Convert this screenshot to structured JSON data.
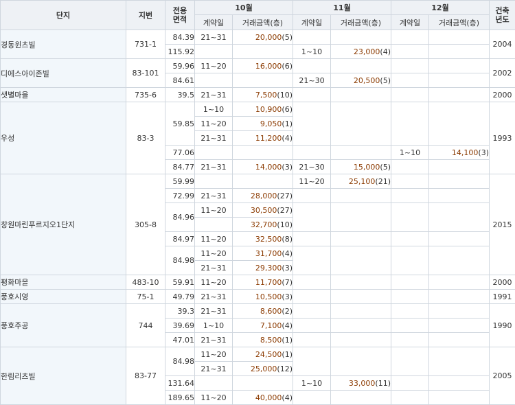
{
  "headers": {
    "complex": "단지",
    "jibun": "지번",
    "area": "전용\n면적",
    "months": [
      "10월",
      "11월",
      "12월"
    ],
    "contract_date": "계약일",
    "amount": "거래금액(층)",
    "built_year": "건축\n년도"
  },
  "complexes": [
    {
      "name": "경동윈츠빌",
      "jibun": "731-1",
      "year": "2004",
      "units": [
        {
          "area": "84.39",
          "deals": [
            {
              "m": 0,
              "date": "21~31",
              "amount": "20,000",
              "floor": "(5)"
            }
          ]
        },
        {
          "area": "115.92",
          "deals": [
            {
              "m": 1,
              "date": "1~10",
              "amount": "23,000",
              "floor": "(4)"
            }
          ]
        }
      ]
    },
    {
      "name": "디에스아이존빌",
      "jibun": "83-101",
      "year": "2002",
      "units": [
        {
          "area": "59.96",
          "deals": [
            {
              "m": 0,
              "date": "11~20",
              "amount": "16,000",
              "floor": "(6)"
            }
          ]
        },
        {
          "area": "84.61",
          "deals": [
            {
              "m": 1,
              "date": "21~30",
              "amount": "20,500",
              "floor": "(5)"
            }
          ]
        }
      ]
    },
    {
      "name": "샛별마을",
      "jibun": "735-6",
      "year": "2000",
      "units": [
        {
          "area": "39.5",
          "deals": [
            {
              "m": 0,
              "date": "21~31",
              "amount": "7,500",
              "floor": "(10)"
            }
          ]
        }
      ]
    },
    {
      "name": "우성",
      "jibun": "83-3",
      "year": "1993",
      "units": [
        {
          "area": "59.85",
          "deals": [
            {
              "m": 0,
              "date": "1~10",
              "amount": "10,900",
              "floor": "(6)"
            },
            {
              "m": 0,
              "date": "11~20",
              "amount": "9,050",
              "floor": "(1)"
            },
            {
              "m": 0,
              "date": "21~31",
              "amount": "11,200",
              "floor": "(4)"
            }
          ]
        },
        {
          "area": "77.06",
          "deals": [
            {
              "m": 2,
              "date": "1~10",
              "amount": "14,100",
              "floor": "(3)"
            }
          ]
        },
        {
          "area": "84.77",
          "deals": [
            {
              "m": 0,
              "date": "21~31",
              "amount": "14,000",
              "floor": "(3)"
            },
            {
              "m": 1,
              "date": "21~30",
              "amount": "15,000",
              "floor": "(5)"
            }
          ]
        }
      ]
    },
    {
      "name": "창원마린푸르지오1단지",
      "jibun": "305-8",
      "year": "2015",
      "units": [
        {
          "area": "59.99",
          "deals": [
            {
              "m": 1,
              "date": "11~20",
              "amount": "25,100",
              "floor": "(21)"
            }
          ]
        },
        {
          "area": "72.99",
          "deals": [
            {
              "m": 0,
              "date": "21~31",
              "amount": "28,000",
              "floor": "(27)"
            }
          ]
        },
        {
          "area": "84.96",
          "deals": [
            {
              "m": 0,
              "date": "11~20",
              "amount": "30,500",
              "floor": "(27)"
            },
            {
              "m": 0,
              "date": "",
              "amount": "32,700",
              "floor": "(10)"
            }
          ]
        },
        {
          "area": "84.97",
          "deals": [
            {
              "m": 0,
              "date": "11~20",
              "amount": "32,500",
              "floor": "(8)"
            }
          ]
        },
        {
          "area": "84.98",
          "deals": [
            {
              "m": 0,
              "date": "11~20",
              "amount": "31,700",
              "floor": "(4)"
            },
            {
              "m": 0,
              "date": "21~31",
              "amount": "29,300",
              "floor": "(3)"
            }
          ]
        }
      ]
    },
    {
      "name": "평화마을",
      "jibun": "483-10",
      "year": "2000",
      "units": [
        {
          "area": "59.91",
          "deals": [
            {
              "m": 0,
              "date": "11~20",
              "amount": "11,700",
              "floor": "(7)"
            }
          ]
        }
      ]
    },
    {
      "name": "풍호시영",
      "jibun": "75-1",
      "year": "1991",
      "units": [
        {
          "area": "49.79",
          "deals": [
            {
              "m": 0,
              "date": "21~31",
              "amount": "10,500",
              "floor": "(3)"
            }
          ]
        }
      ]
    },
    {
      "name": "풍호주공",
      "jibun": "744",
      "year": "1990",
      "units": [
        {
          "area": "39.3",
          "deals": [
            {
              "m": 0,
              "date": "21~31",
              "amount": "8,600",
              "floor": "(2)"
            }
          ]
        },
        {
          "area": "39.69",
          "deals": [
            {
              "m": 0,
              "date": "1~10",
              "amount": "7,100",
              "floor": "(4)"
            }
          ]
        },
        {
          "area": "47.01",
          "deals": [
            {
              "m": 0,
              "date": "21~31",
              "amount": "8,500",
              "floor": "(1)"
            }
          ]
        }
      ]
    },
    {
      "name": "한림리츠빌",
      "jibun": "83-77",
      "year": "2005",
      "units": [
        {
          "area": "84.98",
          "deals": [
            {
              "m": 0,
              "date": "11~20",
              "amount": "24,500",
              "floor": "(1)"
            },
            {
              "m": 0,
              "date": "21~31",
              "amount": "25,000",
              "floor": "(12)"
            }
          ]
        },
        {
          "area": "131.64",
          "deals": [
            {
              "m": 1,
              "date": "1~10",
              "amount": "33,000",
              "floor": "(11)"
            }
          ]
        },
        {
          "area": "189.65",
          "deals": [
            {
              "m": 0,
              "date": "11~20",
              "amount": "40,000",
              "floor": "(4)"
            }
          ]
        }
      ]
    }
  ]
}
